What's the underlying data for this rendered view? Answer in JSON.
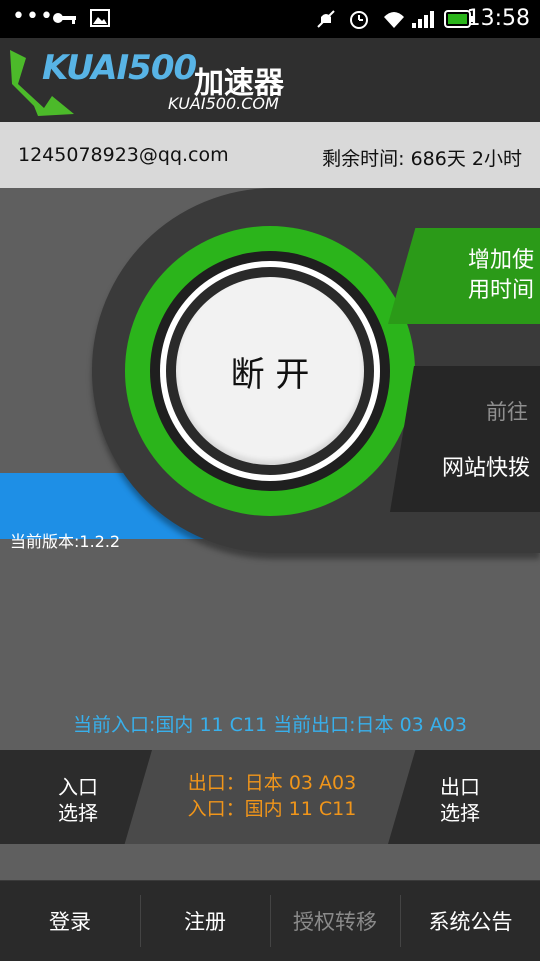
{
  "status_bar": {
    "time": "13:58",
    "icons": [
      "more-dots-icon",
      "key-icon",
      "image-icon",
      "mute-icon",
      "alarm-icon",
      "wifi-icon",
      "signal-icon",
      "battery-icon"
    ]
  },
  "header": {
    "logo_text": "KUAI500",
    "logo_cn": "加速器",
    "logo_url": "KUAI500.COM"
  },
  "account": {
    "email": "1245078923@qq.com",
    "remaining": "剩余时间: 686天 2小时"
  },
  "main": {
    "disconnect_label": "断 开",
    "add_time_line1": "增加使",
    "add_time_line2": "用时间",
    "goto_label": "前往",
    "quick_label": "网站快拨",
    "version": "当前版本:1.2.2",
    "status_line": "当前入口:国内 11 C11 当前出口:日本 03 A03"
  },
  "selector": {
    "left_line1": "入口",
    "left_line2": "选择",
    "center_line1": "出口：日本 03 A03",
    "center_line2": "入口：国内 11 C11",
    "right_line1": "出口",
    "right_line2": "选择"
  },
  "nav": {
    "login": "登录",
    "register": "注册",
    "transfer": "授权转移",
    "notice": "系统公告"
  },
  "colors": {
    "green": "#2bb41b",
    "blue": "#1e8fe6",
    "orange": "#f0951a",
    "status_blue": "#38b0ec"
  }
}
